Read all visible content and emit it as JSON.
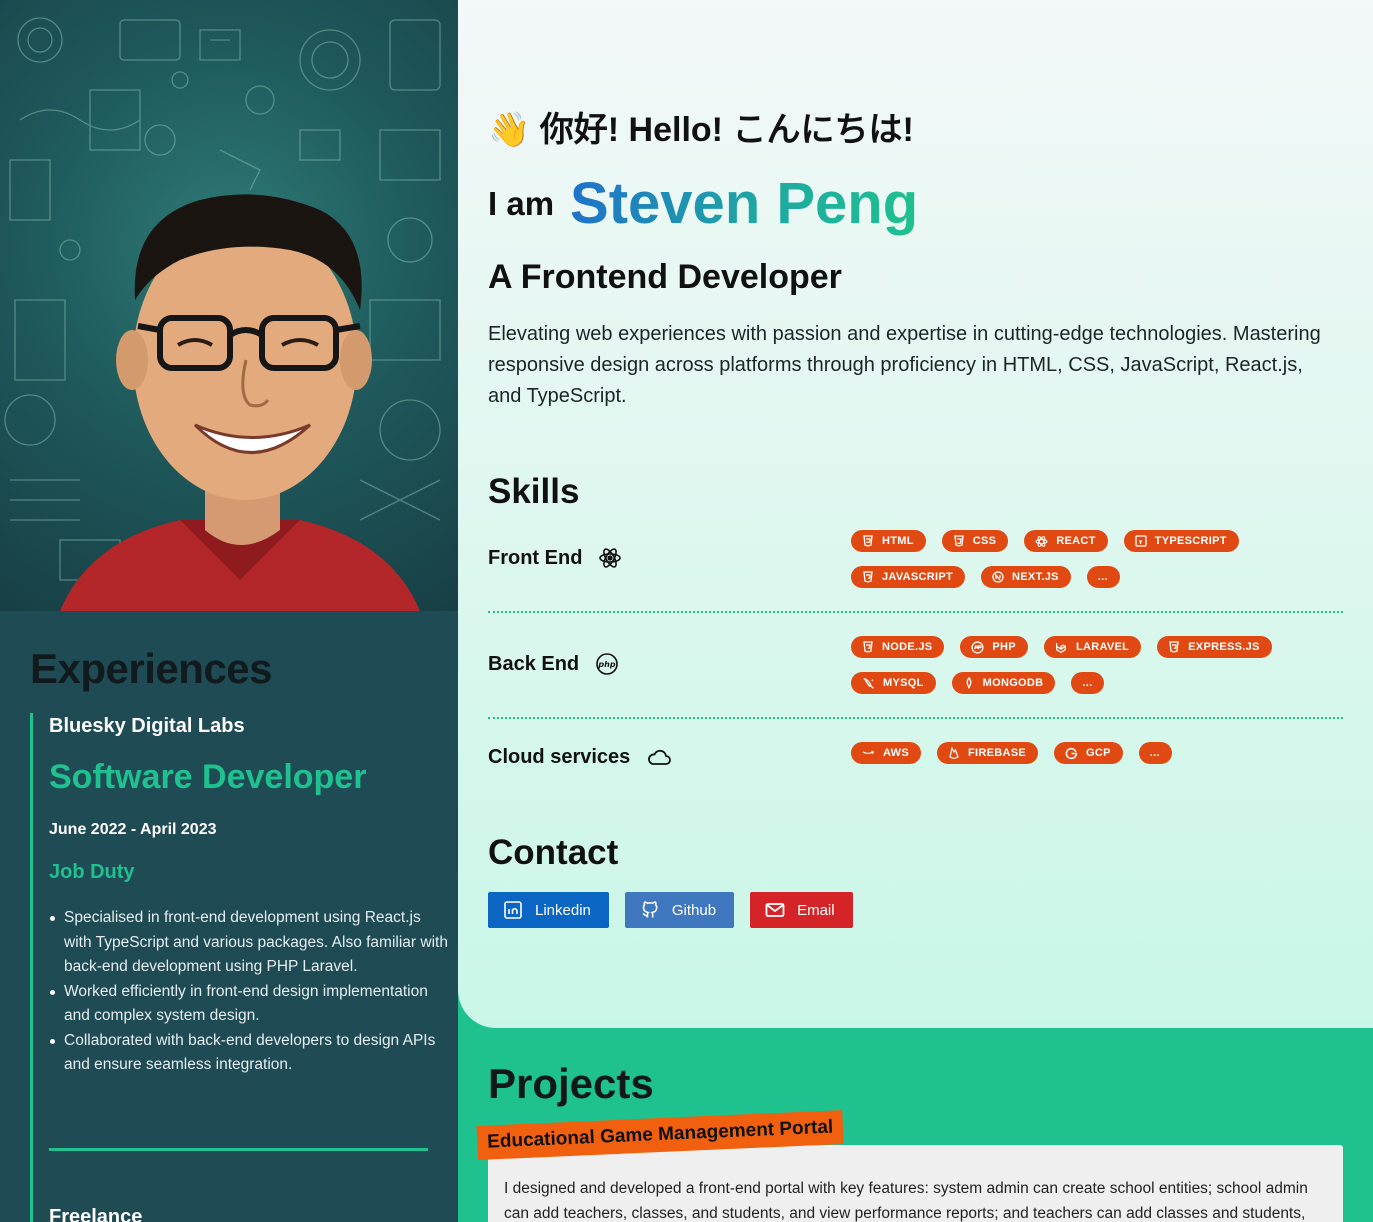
{
  "greeting": "👋 你好! Hello! こんにちは!",
  "intro": {
    "iam": "I am",
    "name": "Steven Peng",
    "title": "A Frontend Developer",
    "description": "Elevating web experiences with passion and expertise in cutting-edge technologies. Mastering responsive design across platforms through proficiency in HTML, CSS, JavaScript, React.js, and TypeScript."
  },
  "skills": {
    "heading": "Skills",
    "groups": [
      {
        "name": "Front End",
        "icon": "react-icon",
        "tags": [
          "HTML",
          "CSS",
          "REACT",
          "TYPESCRIPT",
          "JAVASCRIPT",
          "NEXT.JS",
          "..."
        ]
      },
      {
        "name": "Back End",
        "icon": "php-icon",
        "tags": [
          "NODE.JS",
          "PHP",
          "LARAVEL",
          "EXPRESS.JS",
          "MYSQL",
          "MONGODB",
          "..."
        ]
      },
      {
        "name": "Cloud services",
        "icon": "cloud-icon",
        "tags": [
          "AWS",
          "FIREBASE",
          "GCP",
          "..."
        ]
      }
    ]
  },
  "contact": {
    "heading": "Contact",
    "buttons": [
      {
        "label": "Linkedin",
        "color": "#0a66c2"
      },
      {
        "label": "Github",
        "color": "#4078c0"
      },
      {
        "label": "Email",
        "color": "#d42427"
      }
    ]
  },
  "experiences": {
    "heading": "Experiences",
    "items": [
      {
        "company": "Bluesky Digital Labs",
        "role": "Software Developer",
        "dates": "June 2022 - April 2023",
        "duty_heading": "Job Duty",
        "duties": [
          "Specialised in front-end development using React.js with TypeScript and various packages. Also familiar with back-end development using PHP Laravel.",
          "Worked efficiently in front-end design implementation and complex system design.",
          "Collaborated with back-end developers to design APIs and ensure seamless integration."
        ]
      }
    ],
    "next_company": "Freelance"
  },
  "projects": {
    "heading": "Projects",
    "items": [
      {
        "title": "Educational Game Management Portal",
        "description": "I designed and developed a front-end portal with key features: system admin can create school entities; school admin can add teachers, classes, and students, and view performance reports; and teachers can add classes and students, and"
      }
    ]
  },
  "colors": {
    "accent": "#1fc18f",
    "tag": "#e04a12",
    "sidebar": "#1f4b55"
  }
}
